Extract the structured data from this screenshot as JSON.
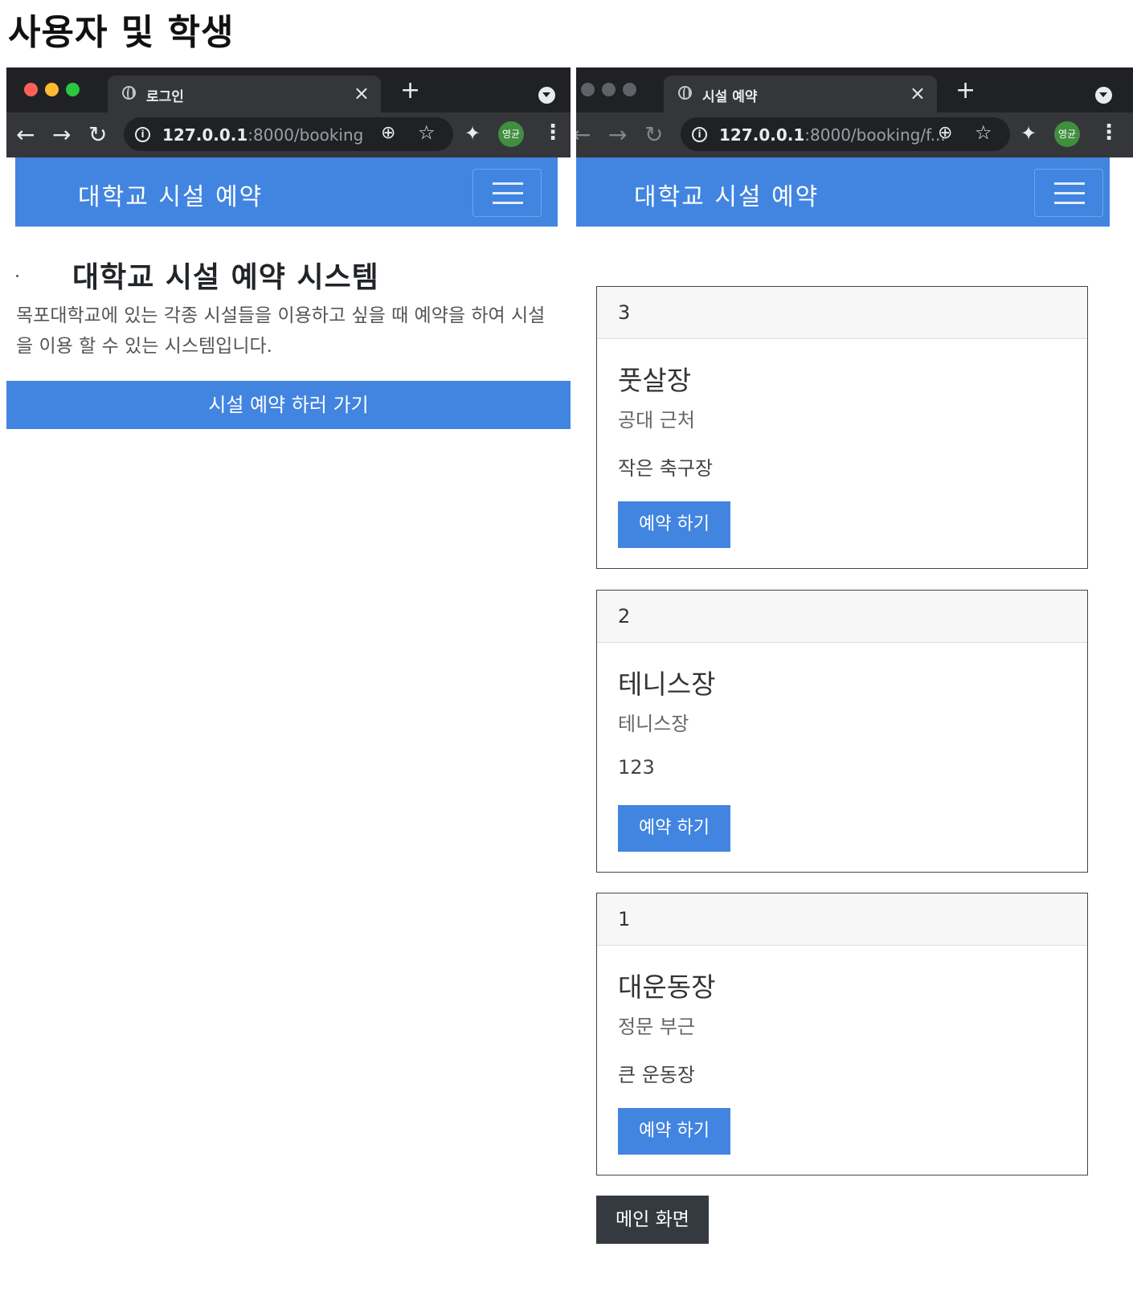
{
  "page_heading": "사용자 및 학생",
  "left_window": {
    "tab_title": "로그인",
    "url_host": "127.0.0.1",
    "url_path": ":8000/booking",
    "profile_label": "영균",
    "navbar_brand": "대학교 시설 예약",
    "hero_title": "대학교 시설 예약 시스템",
    "hero_text": "목포대학교에 있는 각종 시설들을 이용하고 싶을 때 예약을 하여 시설을 이용 할 수 있는 시스템입니다.",
    "goto_button": "시설 예약 하러 가기"
  },
  "right_window": {
    "tab_title": "시설 예약",
    "url_host": "127.0.0.1",
    "url_path": ":8000/booking/f...",
    "profile_label": "영균",
    "navbar_brand": "대학교 시설 예약",
    "cards": [
      {
        "id": "3",
        "title": "풋살장",
        "location": "공대 근처",
        "description": "작은 축구장",
        "button": "예약 하기"
      },
      {
        "id": "2",
        "title": "테니스장",
        "location": "테니스장",
        "description": "123",
        "button": "예약 하기"
      },
      {
        "id": "1",
        "title": "대운동장",
        "location": "정문 부근",
        "description": "큰 운동장",
        "button": "예약 하기"
      }
    ],
    "main_button": "메인 화면"
  },
  "colors": {
    "accent_blue": "#4285e0",
    "chrome_dark": "#202124",
    "chrome_toolbar": "#35363a",
    "dark_button": "#343a40",
    "traffic_red": "#ff5f57",
    "traffic_yellow": "#febc2e",
    "traffic_green": "#28c840",
    "inactive_light": "#5f6368"
  }
}
